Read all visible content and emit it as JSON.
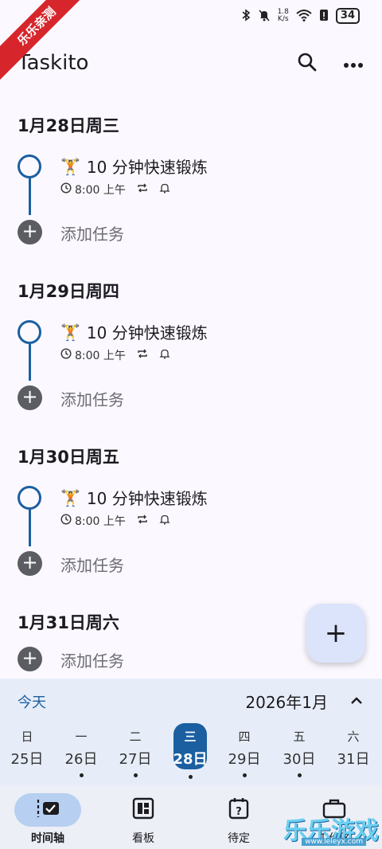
{
  "status_bar": {
    "net_speed_value": "1.8",
    "net_speed_unit": "K/s",
    "battery": "34",
    "corner_banner": "乐乐亲测"
  },
  "app": {
    "title": "Taskito",
    "icons": {
      "search": "search-icon",
      "more": "more-horizontal-icon"
    }
  },
  "days": [
    {
      "header": "1月28日周三",
      "tasks": [
        {
          "emoji": "🏋",
          "title": "10 分钟快速锻炼",
          "time": "8:00 上午",
          "repeat": true,
          "reminder": true
        }
      ],
      "add_label": "添加任务"
    },
    {
      "header": "1月29日周四",
      "tasks": [
        {
          "emoji": "🏋",
          "title": "10 分钟快速锻炼",
          "time": "8:00 上午",
          "repeat": true,
          "reminder": true
        }
      ],
      "add_label": "添加任务"
    },
    {
      "header": "1月30日周五",
      "tasks": [
        {
          "emoji": "🏋",
          "title": "10 分钟快速锻炼",
          "time": "8:00 上午",
          "repeat": true,
          "reminder": true
        }
      ],
      "add_label": "添加任务"
    },
    {
      "header": "1月31日周六",
      "tasks": [],
      "add_label": "添加任务"
    }
  ],
  "fab": {
    "symbol": "+"
  },
  "calendar": {
    "today_label": "今天",
    "month_label": "2026年1月",
    "week": [
      {
        "name": "日",
        "date": "25日",
        "has_task": false,
        "selected": false
      },
      {
        "name": "一",
        "date": "26日",
        "has_task": true,
        "selected": false
      },
      {
        "name": "二",
        "date": "27日",
        "has_task": true,
        "selected": false
      },
      {
        "name": "三",
        "date": "28日",
        "has_task": true,
        "selected": true
      },
      {
        "name": "四",
        "date": "29日",
        "has_task": true,
        "selected": false
      },
      {
        "name": "五",
        "date": "30日",
        "has_task": true,
        "selected": false
      },
      {
        "name": "六",
        "date": "31日",
        "has_task": false,
        "selected": false
      }
    ]
  },
  "nav": {
    "items": [
      {
        "label": "时间轴",
        "icon": "timeline-icon",
        "active": true
      },
      {
        "label": "看板",
        "icon": "board-icon",
        "active": false
      },
      {
        "label": "待定",
        "icon": "pending-icon",
        "active": false
      },
      {
        "label": "工作区",
        "icon": "briefcase-icon",
        "active": false
      }
    ]
  },
  "watermark": {
    "text": "乐乐游戏",
    "url": "www.leleyx.com"
  },
  "colors": {
    "accent": "#1b5fa1",
    "background": "#fbf9ff",
    "calendar_bg": "#e7edf8",
    "fab_bg": "#dbe4fb"
  }
}
